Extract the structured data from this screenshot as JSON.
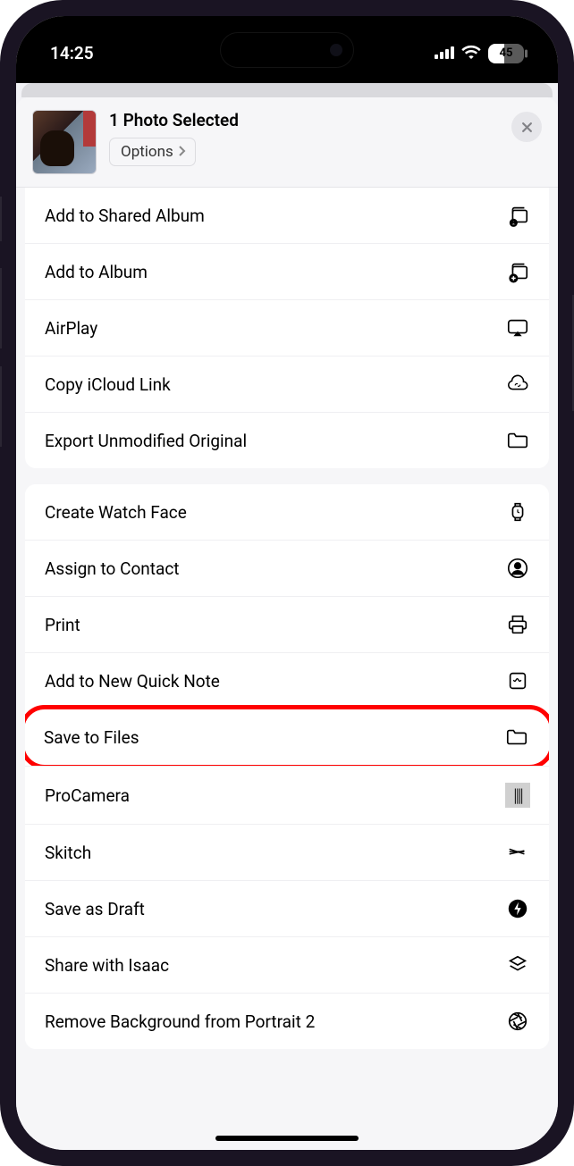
{
  "status_bar": {
    "time": "14:25",
    "battery": "45"
  },
  "header": {
    "title": "1 Photo Selected",
    "options_label": "Options"
  },
  "group1": [
    {
      "label": "Add to Shared Album",
      "icon": "shared-album"
    },
    {
      "label": "Add to Album",
      "icon": "album"
    },
    {
      "label": "AirPlay",
      "icon": "airplay"
    },
    {
      "label": "Copy iCloud Link",
      "icon": "icloud-link"
    },
    {
      "label": "Export Unmodified Original",
      "icon": "folder"
    }
  ],
  "group2": [
    {
      "label": "Create Watch Face",
      "icon": "watch"
    },
    {
      "label": "Assign to Contact",
      "icon": "contact"
    },
    {
      "label": "Print",
      "icon": "print"
    },
    {
      "label": "Add to New Quick Note",
      "icon": "quick-note"
    },
    {
      "label": "Save to Files",
      "icon": "folder",
      "highlight": true
    },
    {
      "label": "ProCamera",
      "icon": "procamera"
    },
    {
      "label": "Skitch",
      "icon": "skitch"
    },
    {
      "label": "Save as Draft",
      "icon": "bolt"
    },
    {
      "label": "Share with Isaac",
      "icon": "stack"
    },
    {
      "label": "Remove Background from Portrait 2",
      "icon": "aperture"
    }
  ]
}
